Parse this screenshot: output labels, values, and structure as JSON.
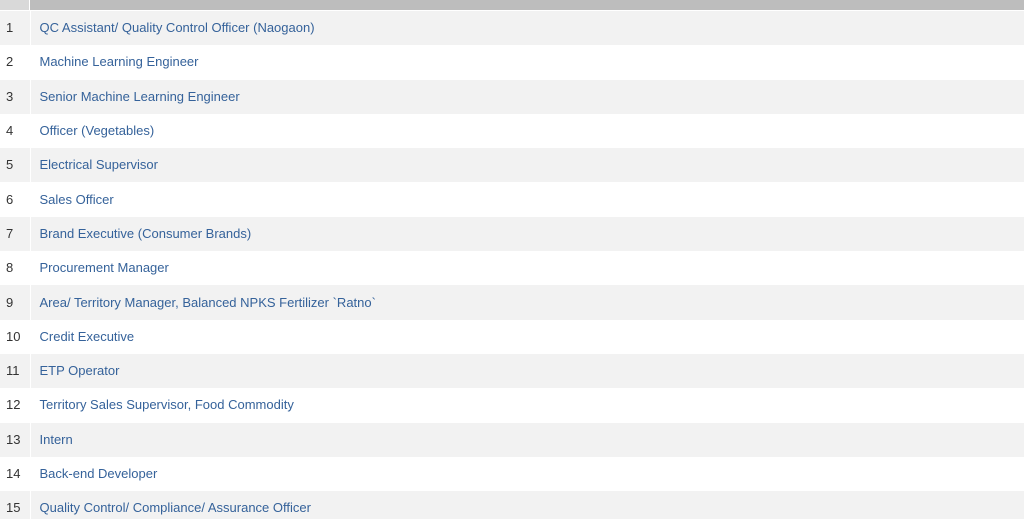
{
  "jobs": [
    {
      "num": "1",
      "title": "QC Assistant/ Quality Control Officer (Naogaon)"
    },
    {
      "num": "2",
      "title": "Machine Learning Engineer"
    },
    {
      "num": "3",
      "title": "Senior Machine Learning Engineer"
    },
    {
      "num": "4",
      "title": "Officer (Vegetables)"
    },
    {
      "num": "5",
      "title": "Electrical Supervisor"
    },
    {
      "num": "6",
      "title": "Sales Officer"
    },
    {
      "num": "7",
      "title": "Brand Executive (Consumer Brands)"
    },
    {
      "num": "8",
      "title": "Procurement Manager"
    },
    {
      "num": "9",
      "title": "Area/ Territory Manager, Balanced NPKS Fertilizer `Ratno`"
    },
    {
      "num": "10",
      "title": "Credit Executive"
    },
    {
      "num": "11",
      "title": "ETP Operator"
    },
    {
      "num": "12",
      "title": "Territory Sales Supervisor, Food Commodity"
    },
    {
      "num": "13",
      "title": "Intern"
    },
    {
      "num": "14",
      "title": "Back-end Developer"
    },
    {
      "num": "15",
      "title": "Quality Control/ Compliance/ Assurance Officer"
    }
  ],
  "colors": {
    "link": "#35629a",
    "row_alt": "#f2f2f2",
    "header": "#bdbdbd"
  }
}
